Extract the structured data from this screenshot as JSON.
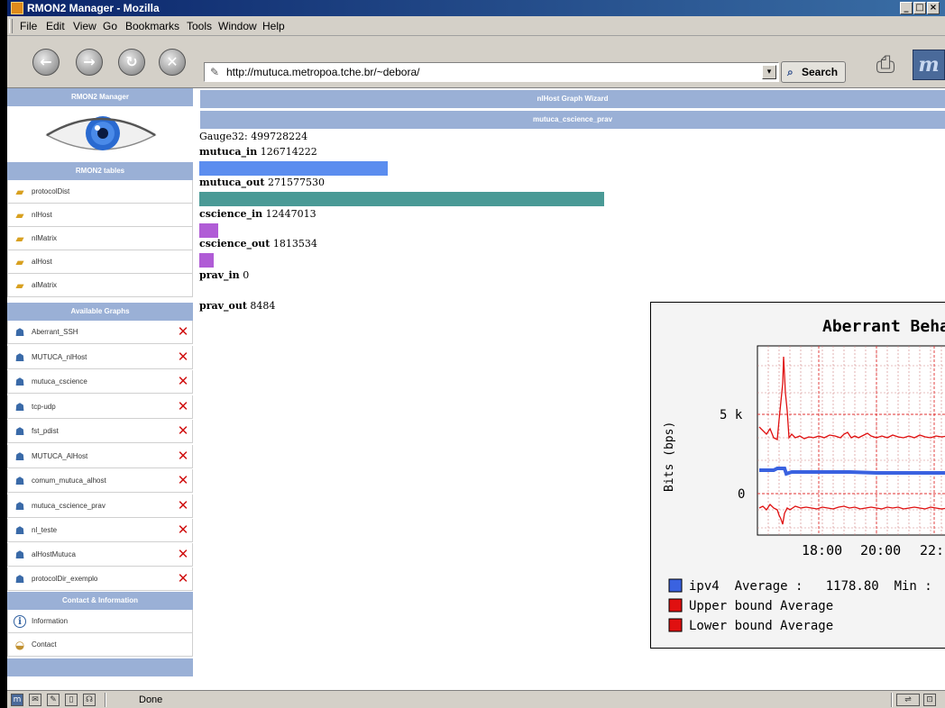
{
  "window": {
    "title": "RMON2 Manager - Mozilla"
  },
  "menu": [
    "File",
    "Edit",
    "View",
    "Go",
    "Bookmarks",
    "Tools",
    "Window",
    "Help"
  ],
  "toolbar": {
    "url": "http://mutuca.metropoa.tche.br/~debora/",
    "search_label": "Search"
  },
  "sidebar": {
    "header": "RMON2 Manager",
    "tables_header": "RMON2 tables",
    "tables": [
      "protocolDist",
      "nlHost",
      "nlMatrix",
      "alHost",
      "alMatrix"
    ],
    "graphs_header": "Available Graphs",
    "graphs": [
      "Aberrant_SSH",
      "MUTUCA_nlHost",
      "mutuca_cscience",
      "tcp-udp",
      "fst_pdist",
      "MUTUCA_AlHost",
      "comum_mutuca_alhost",
      "mutuca_cscience_prav",
      "nl_teste",
      "alHostMutuca",
      "protocolDir_exemplo"
    ],
    "contact_header": "Contact & Information",
    "contact": [
      "Information",
      "Contact"
    ]
  },
  "main": {
    "wizard_header": "nlHost Graph Wizard",
    "graph_title": "mutuca_cscience_prav",
    "gauge_label": "Gauge32:",
    "gauge_value": "499728224",
    "bars": [
      {
        "name": "mutuca_in",
        "value": "126714222",
        "fraction": 0.2536,
        "color": "#5b8def"
      },
      {
        "name": "mutuca_out",
        "value": "271577530",
        "fraction": 0.5434,
        "color": "#4a9a96"
      },
      {
        "name": "cscience_in",
        "value": "12447013",
        "fraction": 0.0249,
        "color": "#b05cd6"
      },
      {
        "name": "cscience_out",
        "value": "1813534",
        "fraction": 0.0036,
        "color": "#b05cd6"
      },
      {
        "name": "prav_in",
        "value": "0",
        "fraction": 0,
        "color": "#b05cd6"
      },
      {
        "name": "prav_out",
        "value": "8484",
        "fraction": 0,
        "color": "#b05cd6"
      }
    ]
  },
  "aberrant_graph": {
    "title": "Aberrant Beha",
    "ylabel": "Bits (bps)",
    "yticks": [
      "5 k",
      "0"
    ],
    "xticks": [
      "18:00",
      "20:00",
      "22:"
    ],
    "legend": [
      {
        "text": "ipv4  Average :   1178.80  Min :",
        "color": "#3a62e0"
      },
      {
        "text": "Upper bound Average",
        "color": "#e01010"
      },
      {
        "text": "Lower bound Average",
        "color": "#e01010"
      }
    ]
  },
  "status": {
    "text": "Done"
  }
}
